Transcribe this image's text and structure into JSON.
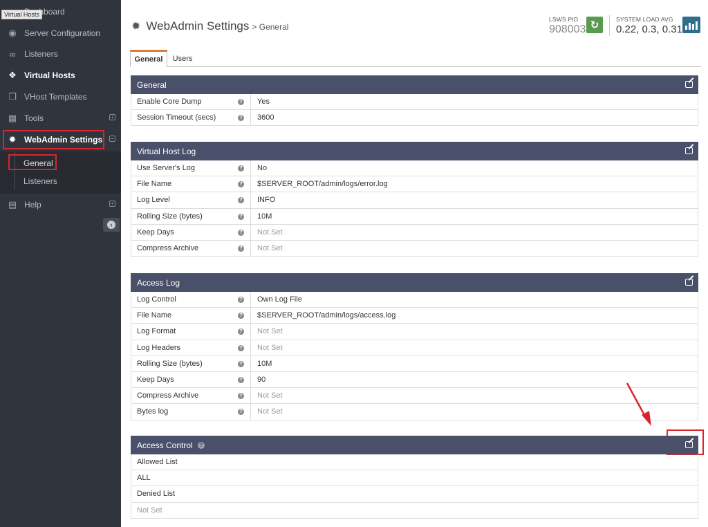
{
  "tooltip": "Virtual Hosts",
  "sidebar": {
    "items": [
      {
        "label": "Dashboard",
        "icon": "dashboard-icon"
      },
      {
        "label": "Server Configuration",
        "icon": "globe-icon"
      },
      {
        "label": "Listeners",
        "icon": "link-icon"
      },
      {
        "label": "Virtual Hosts",
        "icon": "cubes-icon"
      },
      {
        "label": "VHost Templates",
        "icon": "copy-icon"
      },
      {
        "label": "Tools",
        "icon": "grid-icon",
        "expand": "⊞"
      },
      {
        "label": "WebAdmin Settings",
        "icon": "gear-icon",
        "expand": "⊟"
      },
      {
        "label": "Help",
        "icon": "book-icon",
        "expand": "⊞"
      }
    ],
    "submenu": [
      "General",
      "Listeners"
    ]
  },
  "header": {
    "title": "WebAdmin Settings",
    "breadcrumb": "> General",
    "pid_label": "LSWS PID",
    "pid_value": "908003",
    "load_label": "SYSTEM LOAD AVG",
    "load_value": "0.22, 0.3, 0.31"
  },
  "tabs": [
    "General",
    "Users"
  ],
  "panels": {
    "general": {
      "title": "General",
      "rows": [
        {
          "label": "Enable Core Dump",
          "value": "Yes"
        },
        {
          "label": "Session Timeout (secs)",
          "value": "3600"
        }
      ]
    },
    "vhost_log": {
      "title": "Virtual Host Log",
      "rows": [
        {
          "label": "Use Server's Log",
          "value": "No"
        },
        {
          "label": "File Name",
          "value": "$SERVER_ROOT/admin/logs/error.log"
        },
        {
          "label": "Log Level",
          "value": "INFO"
        },
        {
          "label": "Rolling Size (bytes)",
          "value": "10M"
        },
        {
          "label": "Keep Days",
          "value": "Not Set"
        },
        {
          "label": "Compress Archive",
          "value": "Not Set"
        }
      ]
    },
    "access_log": {
      "title": "Access Log",
      "rows": [
        {
          "label": "Log Control",
          "value": "Own Log File"
        },
        {
          "label": "File Name",
          "value": "$SERVER_ROOT/admin/logs/access.log"
        },
        {
          "label": "Log Format",
          "value": "Not Set"
        },
        {
          "label": "Log Headers",
          "value": "Not Set"
        },
        {
          "label": "Rolling Size (bytes)",
          "value": "10M"
        },
        {
          "label": "Keep Days",
          "value": "90"
        },
        {
          "label": "Compress Archive",
          "value": "Not Set"
        },
        {
          "label": "Bytes log",
          "value": "Not Set"
        }
      ]
    },
    "access_control": {
      "title": "Access Control",
      "rows": [
        "Allowed List",
        "ALL",
        "Denied List",
        "Not Set"
      ]
    }
  },
  "colors": {
    "sidebar_bg": "#30343c",
    "panel_header": "#4a5069",
    "highlight_red": "#d9252f",
    "tab_accent": "#e07b39",
    "refresh_green": "#5a9a4e",
    "chart_blue": "#2f6f8c"
  }
}
